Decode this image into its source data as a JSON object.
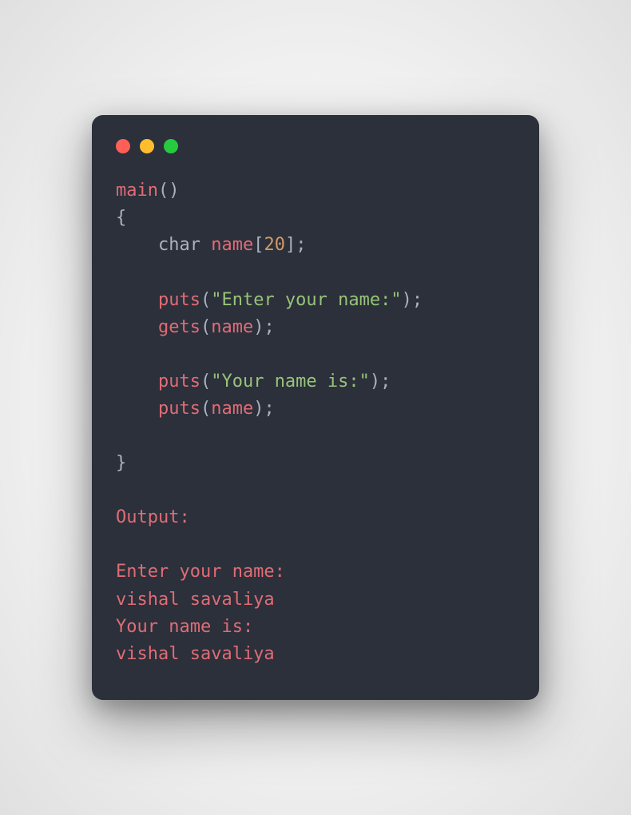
{
  "window": {
    "buttons": {
      "close": "close",
      "minimize": "minimize",
      "maximize": "maximize"
    }
  },
  "code": {
    "main": "main",
    "paren_open": "(",
    "paren_close": ")",
    "brace_open": "{",
    "brace_close": "}",
    "char_kw": "char",
    "name_var": "name",
    "bracket_open": "[",
    "twenty": "20",
    "bracket_close": "]",
    "semicolon": ";",
    "puts_fn": "puts",
    "gets_fn": "gets",
    "str_enter": "\"Enter your name:\"",
    "str_yourname": "\"Your name is:\""
  },
  "output": {
    "label": "Output:",
    "line1": "Enter your name:",
    "line2": "vishal savaliya",
    "line3": "Your name is:",
    "line4": "vishal savaliya"
  }
}
